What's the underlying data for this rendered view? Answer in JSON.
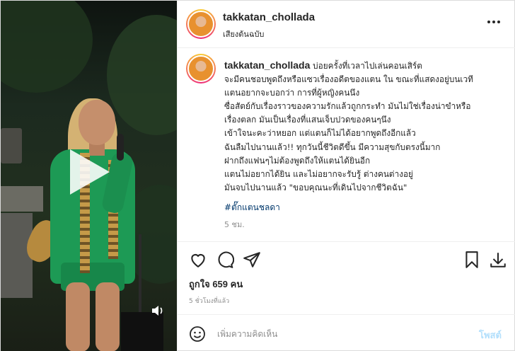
{
  "post": {
    "username": "takkatan_chollada",
    "audio_label": "เสียงต้นฉบับ",
    "caption_user": "takkatan_chollada",
    "caption_text": " บ่อยครั้งที่เวลาไปเล่นคอนเสิร์ต\nจะมีคนชอบพูดถึงหรือแซวเรื่องอดีตของแตน ใน ขณะที่แสดงอยู่บนเวที\nแตนอยากจะบอกว่า การที่ผู้หญิงคนนึง\nซื่อสัตย์กับเรื่องราวของความรักแล้วถูกกระทำ มันไม่ใช่เรื่องน่าขำหรือ\nเรื่องตลก มันเป็นเรื่องที่แสนเจ็บปวดของคนๆนึง\nเข้าใจนะคะว่าหยอก แต่แตนก็ไม่ได้อยากพูดถึงอีกแล้ว\nฉันลืมไปนานแล้ว!! ทุกวันนี้ชีวิตดีขึ้น มีความสุขกับตรงนี้มาก\nฝากถึงแฟนๆไม่ต้องพูดถึงให้แตนได้ยินอีก\nแตนไม่อยากได้ยิน และไม่อยากจะรับรู้ ต่างคนต่างอยู่\nมันจบไปนานแล้ว \"ขอบคุณนะที่เดินไปจากชีวิตฉัน\"",
    "hashtag": "#ตั๊กแตนชลดา",
    "caption_time": "5 ชม.",
    "likes": "ถูกใจ 659 คน",
    "posted_ago": "5 ชั่วโมงที่แล้ว"
  },
  "comment": {
    "placeholder": "เพิ่มความคิดเห็น",
    "post_label": "โพสต์"
  },
  "icons": {
    "more": "more-icon",
    "like": "heart-icon",
    "comment": "comment-icon",
    "share": "share-icon",
    "save": "bookmark-icon",
    "download": "download-icon",
    "emoji": "emoji-icon",
    "play": "play-icon",
    "volume": "volume-icon"
  },
  "colors": {
    "text": "#262626",
    "muted": "#8e8e8e",
    "hashtag": "#00376b",
    "post_button": "#b2dffc",
    "outfit": "#1d9a55"
  }
}
